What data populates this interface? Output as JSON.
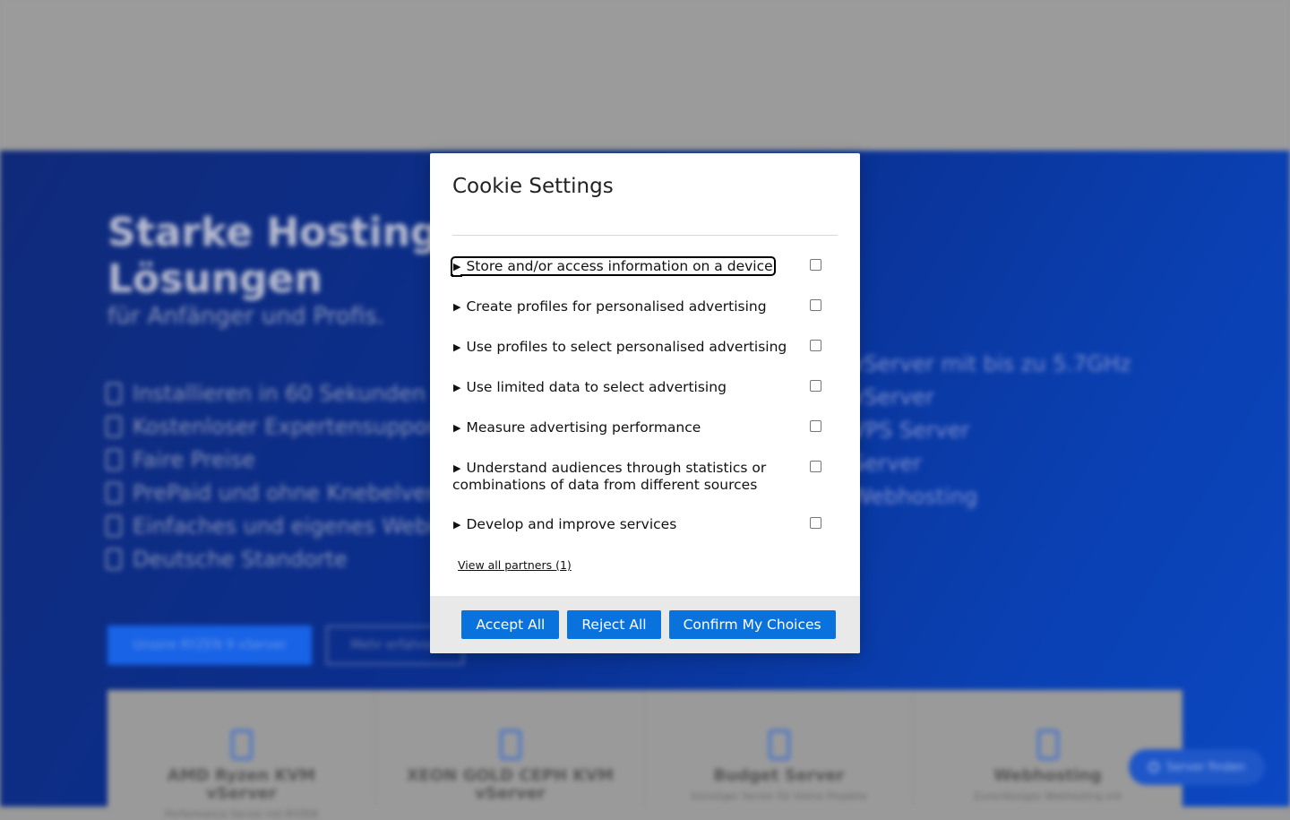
{
  "background": {
    "hero_title_line1": "Starke Hosting",
    "hero_title_line2": "Lösungen",
    "hero_subtitle": "für Anfänger und Profis.",
    "features": [
      "Installieren in 60 Sekunden",
      "Kostenloser Expertensupport",
      "Faire Preise",
      "PrePaid und ohne Knebelverträge",
      "Einfaches und eigenes Webinterface",
      "Deutsche Standorte"
    ],
    "products": [
      "vServer mit bis zu 5.7GHz",
      "vServer",
      "VPS Server",
      "Server",
      "Webhosting"
    ],
    "primary_cta": "Unsere RYZEN 9 vServer",
    "secondary_cta": "Mehr erfahren",
    "cards": [
      {
        "name": "AMD Ryzen KVM vServer",
        "desc": "Performance Server mit RYZEN"
      },
      {
        "name": "XEON GOLD CEPH KVM vServer",
        "desc": ""
      },
      {
        "name": "Budget Server",
        "desc": "Günstiger Server für kleine Projekte"
      },
      {
        "name": "Webhosting",
        "desc": "Zuverlässiges Webhosting mit"
      }
    ],
    "chat_label": "Server finden"
  },
  "modal": {
    "title": "Cookie Settings",
    "purposes": [
      {
        "label": "Store and/or access information on a device",
        "checked": false,
        "focused": true
      },
      {
        "label": "Create profiles for personalised advertising",
        "checked": false
      },
      {
        "label": "Use profiles to select personalised advertising",
        "checked": false
      },
      {
        "label": "Use limited data to select advertising",
        "checked": false
      },
      {
        "label": "Measure advertising performance",
        "checked": false
      },
      {
        "label": "Understand audiences through statistics or combinations of data from different sources",
        "checked": false
      },
      {
        "label": "Develop and improve services",
        "checked": false
      }
    ],
    "partners_link": "View all partners (1)",
    "buttons": {
      "accept_all": "Accept All",
      "reject_all": "Reject All",
      "confirm": "Confirm My Choices"
    }
  },
  "colors": {
    "button_blue": "#0a72dd",
    "hero_blue": "#0a3fb0",
    "footer_gray": "#e9e9e9"
  },
  "icons": {
    "disclosure": "triangle-right-icon",
    "feature_check": "check-box-icon"
  }
}
